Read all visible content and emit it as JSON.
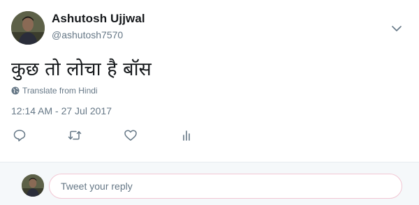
{
  "author": {
    "name": "Ashutosh Ujjwal",
    "handle": "@ashutosh7570"
  },
  "tweet": {
    "text": "कुछ तो लोचा है बॉस",
    "translate_label": "Translate from Hindi",
    "timestamp": "12:14 AM - 27 Jul 2017"
  },
  "actions": [
    "reply-icon",
    "retweet-icon",
    "heart-icon",
    "analytics-icon"
  ],
  "reply": {
    "placeholder": "Tweet your reply"
  },
  "colors": {
    "text_primary": "#14171a",
    "text_secondary": "#657786",
    "divider": "#e6ecf0",
    "reply_bg": "#f5f8fa",
    "input_border": "#f2c6d3"
  }
}
